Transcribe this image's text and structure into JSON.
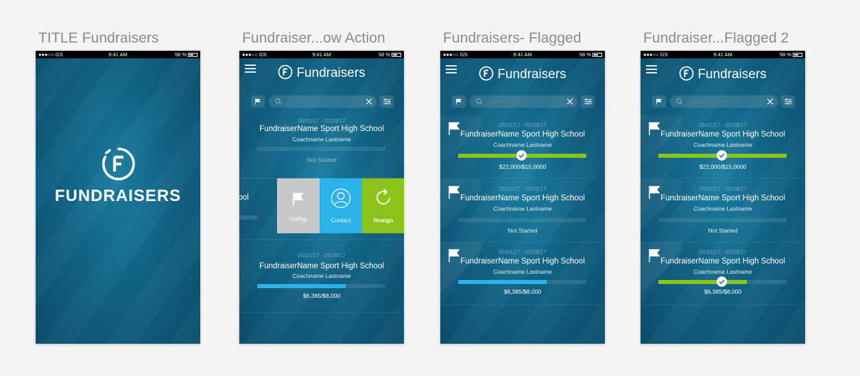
{
  "statusbar": {
    "carrier": "●●●○○ GS",
    "time": "9:41 AM",
    "battery": "58 %"
  },
  "artboards": [
    {
      "label": "TITLE Fundraisers",
      "splash_title": "FUNDRAISERS"
    },
    {
      "label": "Fundraiser...ow Action"
    },
    {
      "label": "Fundraisers- Flagged"
    },
    {
      "label": "Fundraiser...Flagged 2"
    }
  ],
  "app": {
    "title": "Fundraisers",
    "search_placeholder": "Search Contact"
  },
  "screen2": {
    "card1": {
      "dates": "05/01/17 - 05/28/17",
      "name": "FundraiserName Sport High School",
      "coach": "Coachname Lastname",
      "status": "Not Started"
    },
    "swiped_fragment": "hool",
    "actions": [
      {
        "label": "Unflag",
        "color": "#c8c8c8"
      },
      {
        "label": "Contact",
        "color": "#2ab2e9"
      },
      {
        "label": "Resign",
        "color": "#8cc31a"
      }
    ],
    "card3": {
      "dates": "05/01/17 - 05/28/17",
      "name": "FundraiserName Sport High School",
      "coach": "Coachname Lastname",
      "amount": "$6,385/$8,000",
      "progress": 0.69
    }
  },
  "screen3": {
    "cards": [
      {
        "dates": "05/01/17 - 05/28/17",
        "name": "FundraiserName Sport High School",
        "coach": "Coachname Lastname",
        "amount": "$22,000/$15,0000",
        "progress": 1.0,
        "check_at": 0.49,
        "color": "green"
      },
      {
        "dates": "05/01/17 - 05/28/17",
        "name": "FundraiserName Sport High School",
        "coach": "Coachname Lastname",
        "status": "Not Started"
      },
      {
        "dates": "05/01/17 - 05/28/17",
        "name": "FundraiserName Sport High School",
        "coach": "Coachname Lastname",
        "amount": "$6,385/$8,000",
        "progress": 0.69,
        "color": "blue"
      }
    ]
  },
  "screen4": {
    "cards": [
      {
        "dates": "05/01/17 - 05/28/17",
        "name": "FundraiserName Sport High School",
        "coach": "Coachname Lastname",
        "amount": "$22,000/$15,0000",
        "progress": 1.0,
        "check_at": 0.49,
        "color": "green"
      },
      {
        "dates": "05/01/17 - 05/28/17",
        "name": "FundraiserName Sport High School",
        "coach": "Coachname Lastname",
        "status": "Not Started"
      },
      {
        "dates": "05/01/17 - 05/28/17",
        "name": "FundraiserName Sport High School",
        "coach": "Coachname Lastname",
        "amount": "$6,385/$8,000",
        "progress": 0.69,
        "check_at": 0.49,
        "color": "green"
      }
    ]
  }
}
